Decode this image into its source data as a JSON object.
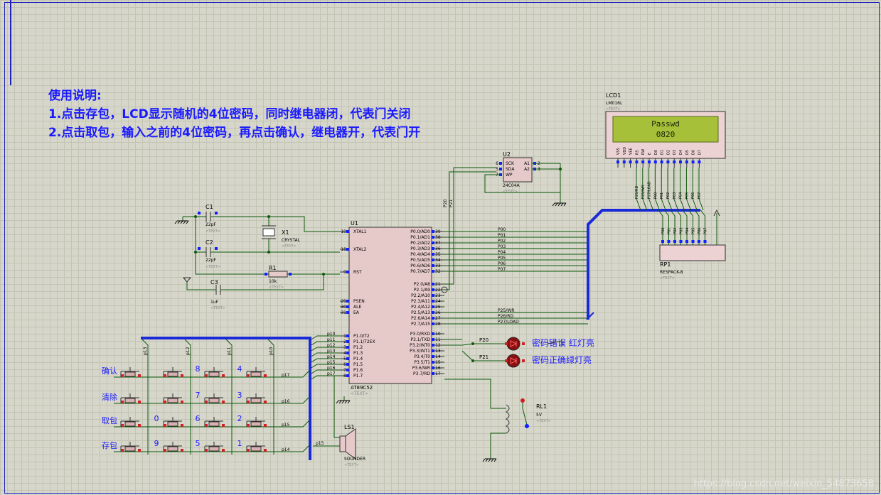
{
  "instructions": {
    "title": "使用说明:",
    "line1": "1.点击存包，LCD显示随机的4位密码，同时继电器闭，代表门关闭",
    "line2": "2.点击取包，输入之前的4位密码，再点击确认，继电器开，代表门开"
  },
  "lcd": {
    "ref": "LCD1",
    "part": "LM016L",
    "text_tag": "<TEXT>",
    "row1": "Passwd",
    "row2": "0820",
    "pins": [
      "VSS",
      "VDD",
      "VEE",
      "RS",
      "RW",
      "E",
      "D0",
      "D1",
      "D2",
      "D3",
      "D4",
      "D5",
      "D6",
      "D7"
    ]
  },
  "u2": {
    "ref": "U2",
    "part": "24C04A",
    "text_tag": "<TEXT>",
    "pins_left": [
      "SCK",
      "SDA",
      "WP"
    ],
    "pins_right": [
      "A1",
      "A2"
    ],
    "pin_nums_left": [
      "6",
      "5",
      "7"
    ],
    "pin_nums_right": [
      "2",
      "3"
    ]
  },
  "u1": {
    "ref": "U1",
    "part": "AT89C52",
    "text_tag": "<TEXT>",
    "left_pins": [
      {
        "n": "19",
        "name": "XTAL1"
      },
      {
        "n": "18",
        "name": "XTAL2"
      },
      {
        "n": "9",
        "name": "RST"
      },
      {
        "n": "29",
        "name": "PSEN"
      },
      {
        "n": "30",
        "name": "ALE"
      },
      {
        "n": "31",
        "name": "EA"
      },
      {
        "n": "1",
        "name": "P1.0/T2"
      },
      {
        "n": "2",
        "name": "P1.1/T2EX"
      },
      {
        "n": "3",
        "name": "P1.2"
      },
      {
        "n": "4",
        "name": "P1.3"
      },
      {
        "n": "5",
        "name": "P1.4"
      },
      {
        "n": "6",
        "name": "P1.5"
      },
      {
        "n": "7",
        "name": "P1.6"
      },
      {
        "n": "8",
        "name": "P1.7"
      }
    ],
    "right_pins": [
      {
        "n": "39",
        "name": "P0.0/AD0"
      },
      {
        "n": "38",
        "name": "P0.1/AD1"
      },
      {
        "n": "37",
        "name": "P0.2/AD2"
      },
      {
        "n": "36",
        "name": "P0.3/AD3"
      },
      {
        "n": "35",
        "name": "P0.4/AD4"
      },
      {
        "n": "34",
        "name": "P0.5/AD5"
      },
      {
        "n": "33",
        "name": "P0.6/AD6"
      },
      {
        "n": "32",
        "name": "P0.7/AD7"
      },
      {
        "n": "21",
        "name": "P2.0/A8"
      },
      {
        "n": "22",
        "name": "P2.1/A9"
      },
      {
        "n": "23",
        "name": "P2.2/A10"
      },
      {
        "n": "24",
        "name": "P2.3/A11"
      },
      {
        "n": "25",
        "name": "P2.4/A12"
      },
      {
        "n": "26",
        "name": "P2.5/A13"
      },
      {
        "n": "27",
        "name": "P2.6/A14"
      },
      {
        "n": "28",
        "name": "P2.7/A15"
      },
      {
        "n": "10",
        "name": "P3.0/RXD"
      },
      {
        "n": "11",
        "name": "P3.1/TXD"
      },
      {
        "n": "12",
        "name": "P3.2/INT0"
      },
      {
        "n": "13",
        "name": "P3.3/INT1"
      },
      {
        "n": "14",
        "name": "P3.4/T0"
      },
      {
        "n": "15",
        "name": "P3.5/T1"
      },
      {
        "n": "16",
        "name": "P3.6/WR"
      },
      {
        "n": "17",
        "name": "P3.7/RD"
      }
    ],
    "p1_nets": [
      "p10",
      "p11",
      "p12",
      "p13",
      "p14",
      "p15",
      "p16",
      "p17"
    ],
    "p0_nets": [
      "P00",
      "P01",
      "P02",
      "P03",
      "P04",
      "P05",
      "P06",
      "P07"
    ],
    "p2_nets": [
      "P25/WR",
      "P26/RD",
      "P27/LOAD"
    ]
  },
  "components": {
    "c1": {
      "ref": "C1",
      "value": "22pF",
      "tag": "<TEXT>"
    },
    "c2": {
      "ref": "C2",
      "value": "22pF",
      "tag": "<TEXT>"
    },
    "c3": {
      "ref": "C3",
      "value": "1uF",
      "tag": "<TEXT>"
    },
    "x1": {
      "ref": "X1",
      "value": "CRYSTAL",
      "tag": "<TEXT>"
    },
    "r1": {
      "ref": "R1",
      "value": "10k",
      "tag": "<TEXT>"
    },
    "rp1": {
      "ref": "RP1",
      "value": "RESPACK-8",
      "tag": "<TEXT>"
    },
    "rl1": {
      "ref": "RL1",
      "value": "5V",
      "tag": "<TEXT>"
    },
    "ls1": {
      "ref": "LS1",
      "value": "SOUNDER",
      "tag": "<TEXT>",
      "net": "p15"
    }
  },
  "leds": [
    {
      "net": "P20",
      "label": "密码错误 红灯亮"
    },
    {
      "net": "P21",
      "label": "密码正确绿灯亮"
    }
  ],
  "keypad": {
    "col_nets": [
      "p13",
      "p12",
      "p11",
      "p10"
    ],
    "row_nets": [
      "p17",
      "p16",
      "p15",
      "p14"
    ],
    "row_labels": [
      "确认",
      "清除",
      "取包",
      "存包"
    ],
    "keys": [
      [
        "",
        "8",
        "4"
      ],
      [
        "",
        "7",
        "3"
      ],
      [
        "0",
        "6",
        "2"
      ],
      [
        "9",
        "5",
        "1"
      ]
    ]
  },
  "lcd_bus_nets": [
    "P25/RD",
    "P25/WR",
    "P27/LOAD",
    "P00",
    "P01",
    "P02",
    "P03",
    "P04",
    "P05",
    "P06",
    "P07"
  ],
  "rp_nets": [
    "P00",
    "P01",
    "P02",
    "P03",
    "P04",
    "P05",
    "P06",
    "P07"
  ],
  "u2_nets": [
    "P20",
    "P21"
  ],
  "watermark": "https://blog.csdn.net/weixin_54873658"
}
